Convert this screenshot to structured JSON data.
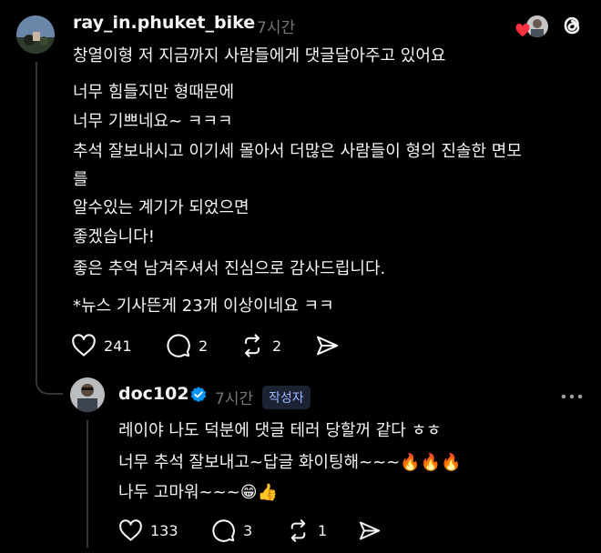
{
  "post": {
    "username": "ray_in.phuket_bike",
    "time": "7시간",
    "lines": [
      "창열이형 저 지금까지 사람들에게 댓글달아주고 있어요",
      "너무 힘들지만 형때문에",
      "너무 기쁘네요~ ㅋㅋㅋ",
      "추석 잘보내시고 이기세 몰아서 더많은 사람들이 형의 진솔한 면모",
      "를",
      "알수있는 계기가 되었으면",
      "좋겠습니다!",
      "좋은 추억 남겨주셔서 진심으로 감사드립니다.",
      "*뉴스 기사뜬게 23개 이상이네요 ㅋㅋ"
    ],
    "likes": "241",
    "comments": "2",
    "reposts": "2"
  },
  "reply": {
    "username": "doc102",
    "time": "7시간",
    "badge": "작성자",
    "lines": [
      "레이야 나도 덕분에 댓글 테러 당할꺼 같다 ㅎㅎ",
      "너무 추석 잘보내고~답글 화이팅해~~~🔥🔥🔥",
      "나두 고마워~~~😁👍"
    ],
    "likes": "133",
    "comments": "3",
    "reposts": "1"
  },
  "icons": {
    "heart": "heart-icon",
    "comment": "comment-icon",
    "repost": "repost-icon",
    "share": "share-icon",
    "threads": "threads-logo-icon",
    "more": "more-icon",
    "verified": "verified-icon"
  },
  "colors": {
    "background": "#000000",
    "text": "#f3f5f7",
    "muted": "#777777",
    "verified": "#0095f6",
    "heart_red": "#ff3040",
    "badge_text": "#9bb7ff"
  }
}
